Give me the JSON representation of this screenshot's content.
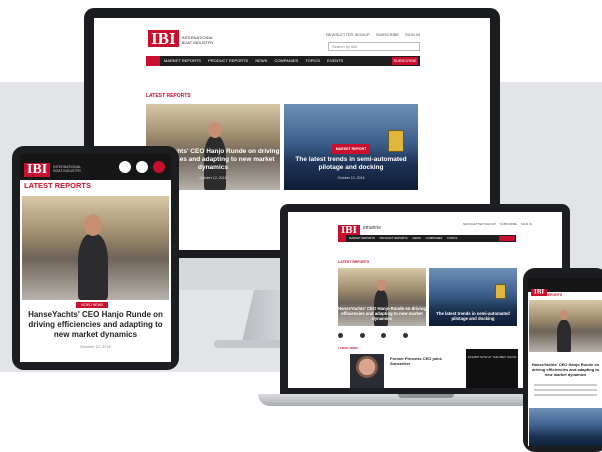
{
  "brand": {
    "logo": "IBI",
    "tagline": "INTERNATIONAL BOAT INDUSTRY",
    "accent": "#c8102e",
    "dark": "#1e1e1e"
  },
  "desktop": {
    "toplinks": [
      "NEWSLETTER SIGNUP",
      "SUBSCRIBE",
      "SIGN IN"
    ],
    "search_placeholder": "Search by title",
    "nav": [
      "MARKET REPORTS",
      "PRODUCT REPORTS",
      "NEWS",
      "COMPANIES",
      "TOPICS",
      "EVENTS"
    ],
    "subscribe": "SUBSCRIBE",
    "latest": "LATEST REPORTS",
    "card1": {
      "title": "HanseYachts' CEO Hanjo Runde on driving efficiencies and adapting to new market dynamics",
      "date": "October 12, 2016"
    },
    "card2": {
      "tag": "MARKET REPORT",
      "title": "The latest trends in semi-automated pilotage and docking",
      "date": "October 12, 2016"
    }
  },
  "laptop": {
    "logo_suffix": "emarine",
    "latest": "LATEST REPORTS",
    "card1_title": "HanseYachts' CEO Hanjo Runde on driving efficiencies and adapting to new market dynamics",
    "card2_title": "The latest trends in semi-automated pilotage and docking",
    "section2": "LATEST NEWS",
    "story_title": "Former Princess CEO joins Sunseeker",
    "ad_text": "EXHIBIT NOW AT THE IBEX SHOW"
  },
  "tablet": {
    "latest": "LATEST REPORTS",
    "tag": "VIDEO NEWS",
    "headline": "HanseYachts' CEO Hanjo Runde on driving efficiencies and adapting to new market dynamics",
    "date": "October 12, 2016"
  },
  "phone": {
    "latest": "LATEST REPORTS",
    "headline": "HanseYachts' CEO Hanjo Runde on driving efficiencies and adapting to new market dynamics"
  }
}
